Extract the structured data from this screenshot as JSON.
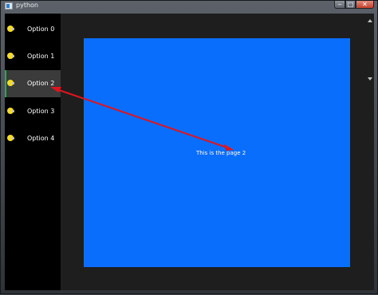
{
  "window": {
    "title": "python",
    "controls": {
      "minimize": "‒",
      "maximize": "□",
      "close": "✕"
    }
  },
  "sidebar": {
    "items": [
      {
        "label": "Option 0",
        "selected": false
      },
      {
        "label": "Option 1",
        "selected": false
      },
      {
        "label": "Option 2",
        "selected": true
      },
      {
        "label": "Option 3",
        "selected": false
      },
      {
        "label": "Option 4",
        "selected": false
      }
    ],
    "icon": "lightbulb-icon"
  },
  "page": {
    "text": "This is the page 2"
  },
  "colors": {
    "page_background": "#0a6efc",
    "sidebar_background": "#000000",
    "selected_item_background": "#3b3b3b",
    "selected_indicator": "#2ca84a",
    "bulb": "#f3dc2a",
    "annotation_arrow": "#e0141e"
  }
}
